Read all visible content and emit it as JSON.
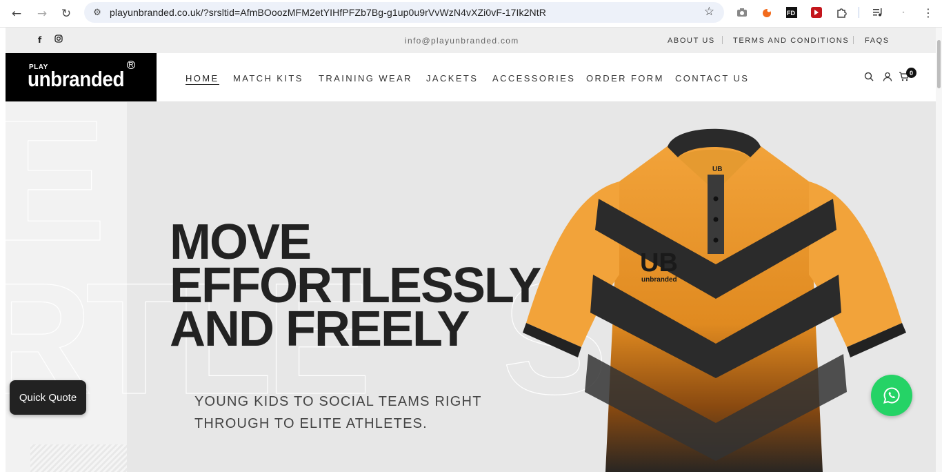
{
  "browser": {
    "url": "playunbranded.co.uk/?srsltid=AfmBOoozMFM2etYIHfPFZb7Bg-g1up0u9rVvWzN4vXZi0vF-17Ik2NtR",
    "icons": [
      "back-icon",
      "forward-icon",
      "reload-icon",
      "site-info-icon",
      "bookmark-star-icon",
      "camera-icon",
      "extension-icons",
      "menu-icon"
    ]
  },
  "topbar": {
    "email": "info@playunbranded.com",
    "links": [
      "ABOUT US",
      "TERMS AND CONDITIONS",
      "FAQS"
    ],
    "social": [
      "facebook-icon",
      "instagram-icon"
    ]
  },
  "header": {
    "logo_small": "PLAY",
    "logo_main": "unbranded",
    "logo_mark": "R",
    "menu": [
      "HOME",
      "MATCH KITS",
      "TRAINING WEAR",
      "JACKETS",
      "ACCESSORIES",
      "ORDER FORM",
      "CONTACT US"
    ],
    "cart_count": "0"
  },
  "hero": {
    "headline": [
      "MOVE",
      "EFFORTLESSLY",
      "AND FREELY"
    ],
    "subtext": [
      "YOUNG KIDS TO SOCIAL TEAMS RIGHT",
      "THROUGH TO ELITE ATHLETES."
    ],
    "shirt_badge": "UB",
    "shirt_brand": "unbranded",
    "shirt_collar": "UB"
  },
  "widgets": {
    "quick_quote": "Quick Quote"
  },
  "colors": {
    "accent_orange": "#f0a23a",
    "whatsapp_green": "#25d366",
    "dark": "#222222"
  }
}
